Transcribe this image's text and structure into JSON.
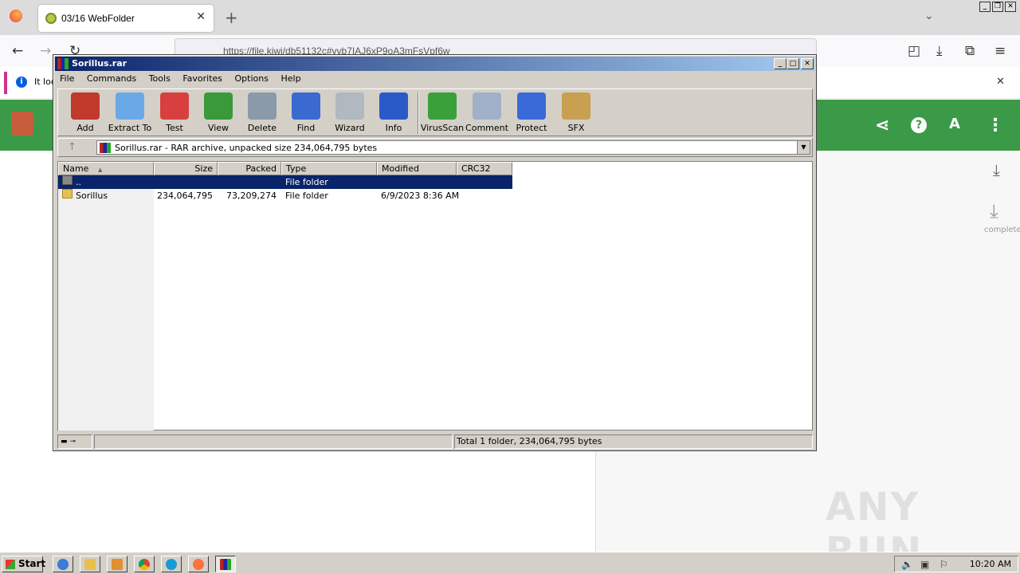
{
  "browser": {
    "tab_title": "03/16 WebFolder",
    "tab_close": "✕",
    "new_tab": "+",
    "url": "https://file.kiwi/db51132c#vvb7IAJ6xP9oA3mFsVpf6w",
    "info_text": "It loo",
    "info_close": "✕",
    "nav": {
      "back": "←",
      "forward": "→",
      "reload": "↻",
      "pocket": "◰",
      "download": "⤓",
      "extensions": "⧉",
      "menu": "≡"
    },
    "window_controls": {
      "minimize": "_",
      "restore": "❐",
      "close": "✕"
    }
  },
  "site": {
    "header_icons": {
      "share": "⋖",
      "help": "?",
      "translate": "A",
      "more": "⋮"
    },
    "download_label": "complete",
    "watermark": "ANY RUN"
  },
  "winrar": {
    "title": "Sorillus.rar",
    "title_buttons": {
      "minimize": "_",
      "maximize": "□",
      "close": "✕"
    },
    "menu": [
      "File",
      "Commands",
      "Tools",
      "Favorites",
      "Options",
      "Help"
    ],
    "toolbar": [
      {
        "label": "Add",
        "icon": "add-icon",
        "color": "#c0392b"
      },
      {
        "label": "Extract To",
        "icon": "extract-to-icon",
        "color": "#6aa8e8"
      },
      {
        "label": "Test",
        "icon": "test-icon",
        "color": "#d84040"
      },
      {
        "label": "View",
        "icon": "view-icon",
        "color": "#3a9a3a"
      },
      {
        "label": "Delete",
        "icon": "delete-icon",
        "color": "#8a9aaa"
      },
      {
        "label": "Find",
        "icon": "find-icon",
        "color": "#3a6ad0"
      },
      {
        "label": "Wizard",
        "icon": "wizard-icon",
        "color": "#b0b8c0"
      },
      {
        "label": "Info",
        "icon": "info-icon",
        "color": "#2a5ac8"
      },
      {
        "label": "VirusScan",
        "icon": "virusscan-icon",
        "color": "#3aa03a"
      },
      {
        "label": "Comment",
        "icon": "comment-icon",
        "color": "#a0b0c8"
      },
      {
        "label": "Protect",
        "icon": "protect-icon",
        "color": "#3a6ad8"
      },
      {
        "label": "SFX",
        "icon": "sfx-icon",
        "color": "#c8a050"
      }
    ],
    "up_arrow": "↑",
    "address": "Sorillus.rar - RAR archive, unpacked size 234,064,795 bytes",
    "dropdown": "▼",
    "columns": [
      "Name",
      "Size",
      "Packed",
      "Type",
      "Modified",
      "CRC32"
    ],
    "sort_indicator": "▲",
    "rows": [
      {
        "name": "..",
        "size": "",
        "packed": "",
        "type": "File folder",
        "modified": "",
        "crc": "",
        "selected": true
      },
      {
        "name": "Sorillus",
        "size": "234,064,795",
        "packed": "73,209,274",
        "type": "File folder",
        "modified": "6/9/2023 8:36 AM",
        "crc": "",
        "selected": false
      }
    ],
    "status_icons": "▬ ⊸",
    "status_text": "Total 1 folder, 234,064,795 bytes"
  },
  "taskbar": {
    "start_label": "Start",
    "clock": "10:20 AM",
    "tray_icons": [
      "volume-icon",
      "network-icon",
      "flag-icon"
    ]
  }
}
